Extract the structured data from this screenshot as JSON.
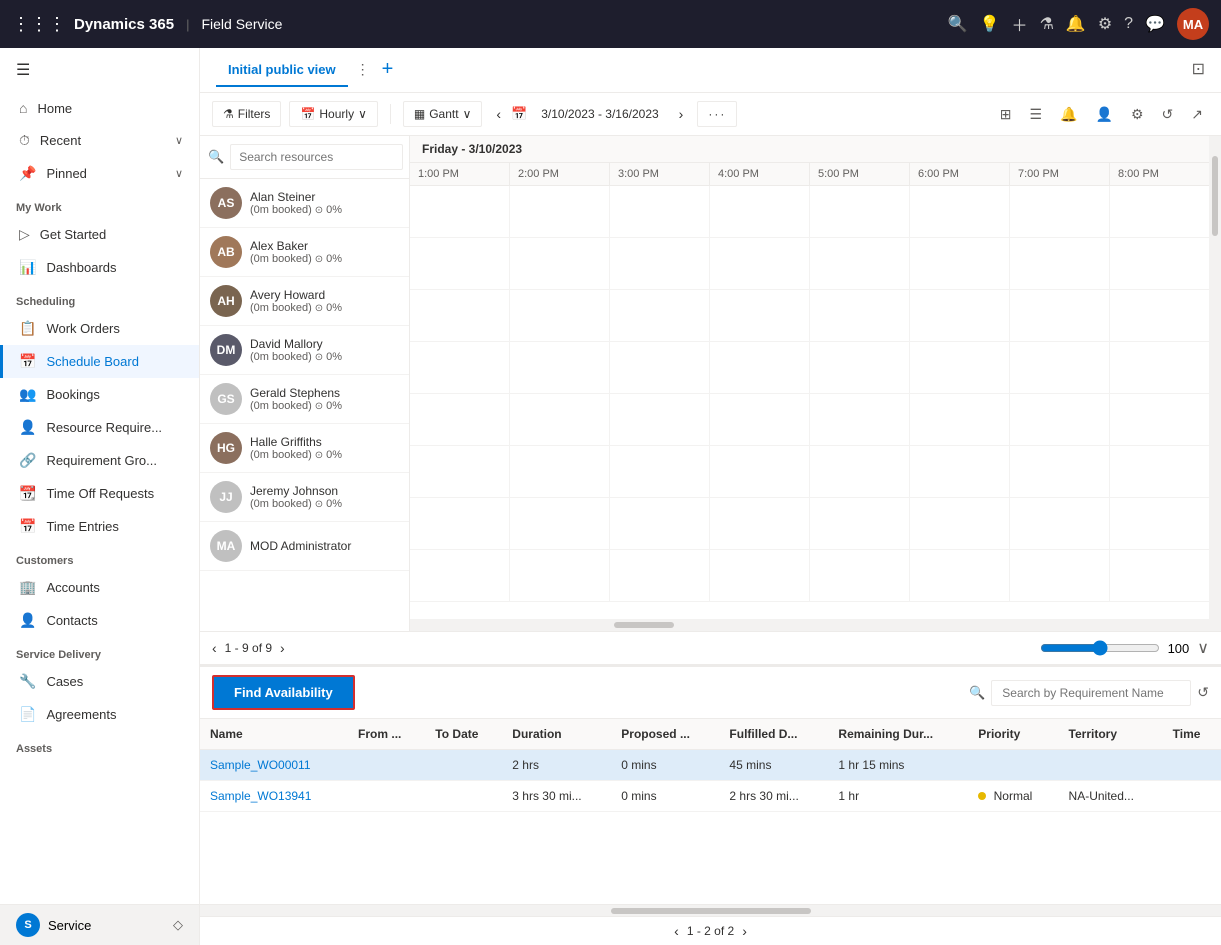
{
  "topNav": {
    "appName": "Dynamics 365",
    "separator": "|",
    "moduleName": "Field Service",
    "avatarText": "MA",
    "avatarBg": "#c43e1c"
  },
  "sidebar": {
    "sections": [
      {
        "header": null,
        "items": [
          {
            "id": "home",
            "label": "Home",
            "icon": "⌂"
          },
          {
            "id": "recent",
            "label": "Recent",
            "icon": "⏱",
            "hasChevron": true
          },
          {
            "id": "pinned",
            "label": "Pinned",
            "icon": "📌",
            "hasChevron": true
          }
        ]
      },
      {
        "header": "My Work",
        "items": [
          {
            "id": "get-started",
            "label": "Get Started",
            "icon": "▷"
          },
          {
            "id": "dashboards",
            "label": "Dashboards",
            "icon": "📊"
          }
        ]
      },
      {
        "header": "Scheduling",
        "items": [
          {
            "id": "work-orders",
            "label": "Work Orders",
            "icon": "📋"
          },
          {
            "id": "schedule-board",
            "label": "Schedule Board",
            "icon": "📅",
            "active": true
          },
          {
            "id": "bookings",
            "label": "Bookings",
            "icon": "👥"
          },
          {
            "id": "resource-require",
            "label": "Resource Require...",
            "icon": "👤"
          },
          {
            "id": "requirement-gro",
            "label": "Requirement Gro...",
            "icon": "🔗"
          },
          {
            "id": "time-off",
            "label": "Time Off Requests",
            "icon": "📆"
          },
          {
            "id": "time-entries",
            "label": "Time Entries",
            "icon": "📅"
          }
        ]
      },
      {
        "header": "Customers",
        "items": [
          {
            "id": "accounts",
            "label": "Accounts",
            "icon": "🏢"
          },
          {
            "id": "contacts",
            "label": "Contacts",
            "icon": "👤"
          }
        ]
      },
      {
        "header": "Service Delivery",
        "items": [
          {
            "id": "cases",
            "label": "Cases",
            "icon": "🔧"
          },
          {
            "id": "agreements",
            "label": "Agreements",
            "icon": "📄"
          }
        ]
      },
      {
        "header": "Assets",
        "items": []
      }
    ],
    "bottomItem": {
      "label": "Service",
      "icon": "S"
    }
  },
  "board": {
    "viewTab": "Initial public view",
    "toolbar": {
      "filters": "Filters",
      "view": "Hourly",
      "gantt": "Gantt",
      "datePrev": "‹",
      "dateNext": "›",
      "dateRange": "3/10/2023 - 3/16/2023",
      "moreOptions": "···"
    },
    "dateHeader": "Friday - 3/10/2023",
    "timeHeaders": [
      "1:00 PM",
      "2:00 PM",
      "3:00 PM",
      "4:00 PM",
      "5:00 PM",
      "6:00 PM",
      "7:00 PM",
      "8:00 PM"
    ],
    "searchPlaceholder": "Search resources",
    "resources": [
      {
        "id": "alan-steiner",
        "name": "Alan Steiner",
        "status": "(0m booked)",
        "pct": "0%",
        "avatarColor": "#8b6f5e",
        "initials": "AS"
      },
      {
        "id": "alex-baker",
        "name": "Alex Baker",
        "status": "(0m booked)",
        "pct": "0%",
        "avatarColor": "#a0785a",
        "initials": "AB"
      },
      {
        "id": "avery-howard",
        "name": "Avery Howard",
        "status": "(0m booked)",
        "pct": "0%",
        "avatarColor": "#7a6550",
        "initials": "AH"
      },
      {
        "id": "david-mallory",
        "name": "David Mallory",
        "status": "(0m booked)",
        "pct": "0%",
        "avatarColor": "#5a5a6a",
        "initials": "DM"
      },
      {
        "id": "gerald-stephens",
        "name": "Gerald Stephens",
        "status": "(0m booked)",
        "pct": "0%",
        "avatarColor": "#c0c0c0",
        "initials": "GS"
      },
      {
        "id": "halle-griffiths",
        "name": "Halle Griffiths",
        "status": "(0m booked)",
        "pct": "0%",
        "avatarColor": "#8b6f5e",
        "initials": "HG"
      },
      {
        "id": "jeremy-johnson",
        "name": "Jeremy Johnson",
        "status": "(0m booked)",
        "pct": "0%",
        "avatarColor": "#c0c0c0",
        "initials": "JJ"
      },
      {
        "id": "mod-admin",
        "name": "MOD Administrator",
        "status": "",
        "pct": "",
        "avatarColor": "#c0c0c0",
        "initials": "MA"
      }
    ],
    "pagination": {
      "current": "1 - 9 of 9"
    },
    "zoom": "100"
  },
  "requirements": {
    "findAvailabilityLabel": "Find Availability",
    "searchPlaceholder": "Search by Requirement Name",
    "columns": [
      "Name",
      "From ...",
      "To Date",
      "Duration",
      "Proposed ...",
      "Fulfilled D...",
      "Remaining Dur...",
      "Priority",
      "Territory",
      "Time"
    ],
    "rows": [
      {
        "id": "row1",
        "name": "Sample_WO00011",
        "from": "",
        "toDate": "",
        "duration": "2 hrs",
        "proposed": "0 mins",
        "fulfilled": "45 mins",
        "remaining": "1 hr 15 mins",
        "priority": "",
        "priorityColor": null,
        "territory": "",
        "time": "",
        "selected": true
      },
      {
        "id": "row2",
        "name": "Sample_WO13941",
        "from": "",
        "toDate": "",
        "duration": "3 hrs 30 mi...",
        "proposed": "0 mins",
        "fulfilled": "2 hrs 30 mi...",
        "remaining": "1 hr",
        "priority": "Normal",
        "priorityColor": "#e6b800",
        "territory": "NA-United...",
        "time": "",
        "selected": false
      }
    ],
    "pagination": {
      "prev": "‹",
      "next": "›",
      "current": "1 - 2 of 2"
    }
  }
}
